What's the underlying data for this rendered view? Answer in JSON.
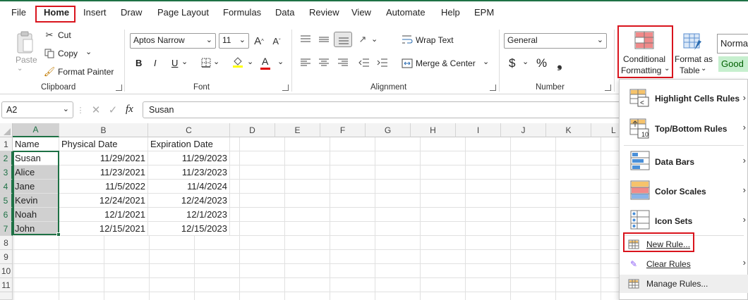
{
  "menu": {
    "tabs": [
      "File",
      "Home",
      "Insert",
      "Draw",
      "Page Layout",
      "Formulas",
      "Data",
      "Review",
      "View",
      "Automate",
      "Help",
      "EPM"
    ]
  },
  "ribbon": {
    "clipboard": {
      "paste": "Paste",
      "cut": "Cut",
      "copy": "Copy",
      "format_painter": "Format Painter",
      "label": "Clipboard"
    },
    "font": {
      "name": "Aptos Narrow",
      "size": "11",
      "bold": "B",
      "italic": "I",
      "underline": "U",
      "font_color_glyph": "A",
      "label": "Font"
    },
    "alignment": {
      "wrap_text": "Wrap Text",
      "merge_center": "Merge & Center",
      "label": "Alignment"
    },
    "number": {
      "format": "General",
      "currency": "$",
      "percent": "%",
      "label": "Number"
    },
    "styles": {
      "conditional_formatting_line1": "Conditional",
      "conditional_formatting_line2": "Formatting",
      "format_as_table_line1": "Format as",
      "format_as_table_line2": "Table",
      "normal": "Norma",
      "good": "Good"
    }
  },
  "formula_bar": {
    "name_box": "A2",
    "fx": "fx",
    "content": "Susan"
  },
  "grid": {
    "columns": [
      "A",
      "B",
      "C",
      "D",
      "E",
      "F",
      "G",
      "H",
      "I",
      "J",
      "K",
      "L"
    ],
    "rows": [
      "1",
      "2",
      "3",
      "4",
      "5",
      "6",
      "7",
      "8",
      "9",
      "10",
      "11"
    ],
    "header": [
      "Name",
      "Physical Date",
      "Expiration Date"
    ],
    "data": [
      [
        "Susan",
        "11/29/2021",
        "11/29/2023"
      ],
      [
        "Alice",
        "11/23/2021",
        "11/23/2023"
      ],
      [
        "Jane",
        "11/5/2022",
        "11/4/2024"
      ],
      [
        "Kevin",
        "12/24/2021",
        "12/24/2023"
      ],
      [
        "Noah",
        "12/1/2021",
        "12/1/2023"
      ],
      [
        "John",
        "12/15/2021",
        "12/15/2023"
      ]
    ]
  },
  "cf_menu": {
    "highlight": "Highlight Cells Rules",
    "topbottom": "Top/Bottom Rules",
    "databars": "Data Bars",
    "colorscales": "Color Scales",
    "iconsets": "Icon Sets",
    "newrule": "New Rule...",
    "clearrules": "Clear Rules",
    "managerules": "Manage Rules...",
    "topbottom_icon_number": "10"
  },
  "colors": {
    "accent": "#1e7145",
    "highlight_box": "#d9141d",
    "good_bg": "#c6efce",
    "good_text": "#006100"
  }
}
